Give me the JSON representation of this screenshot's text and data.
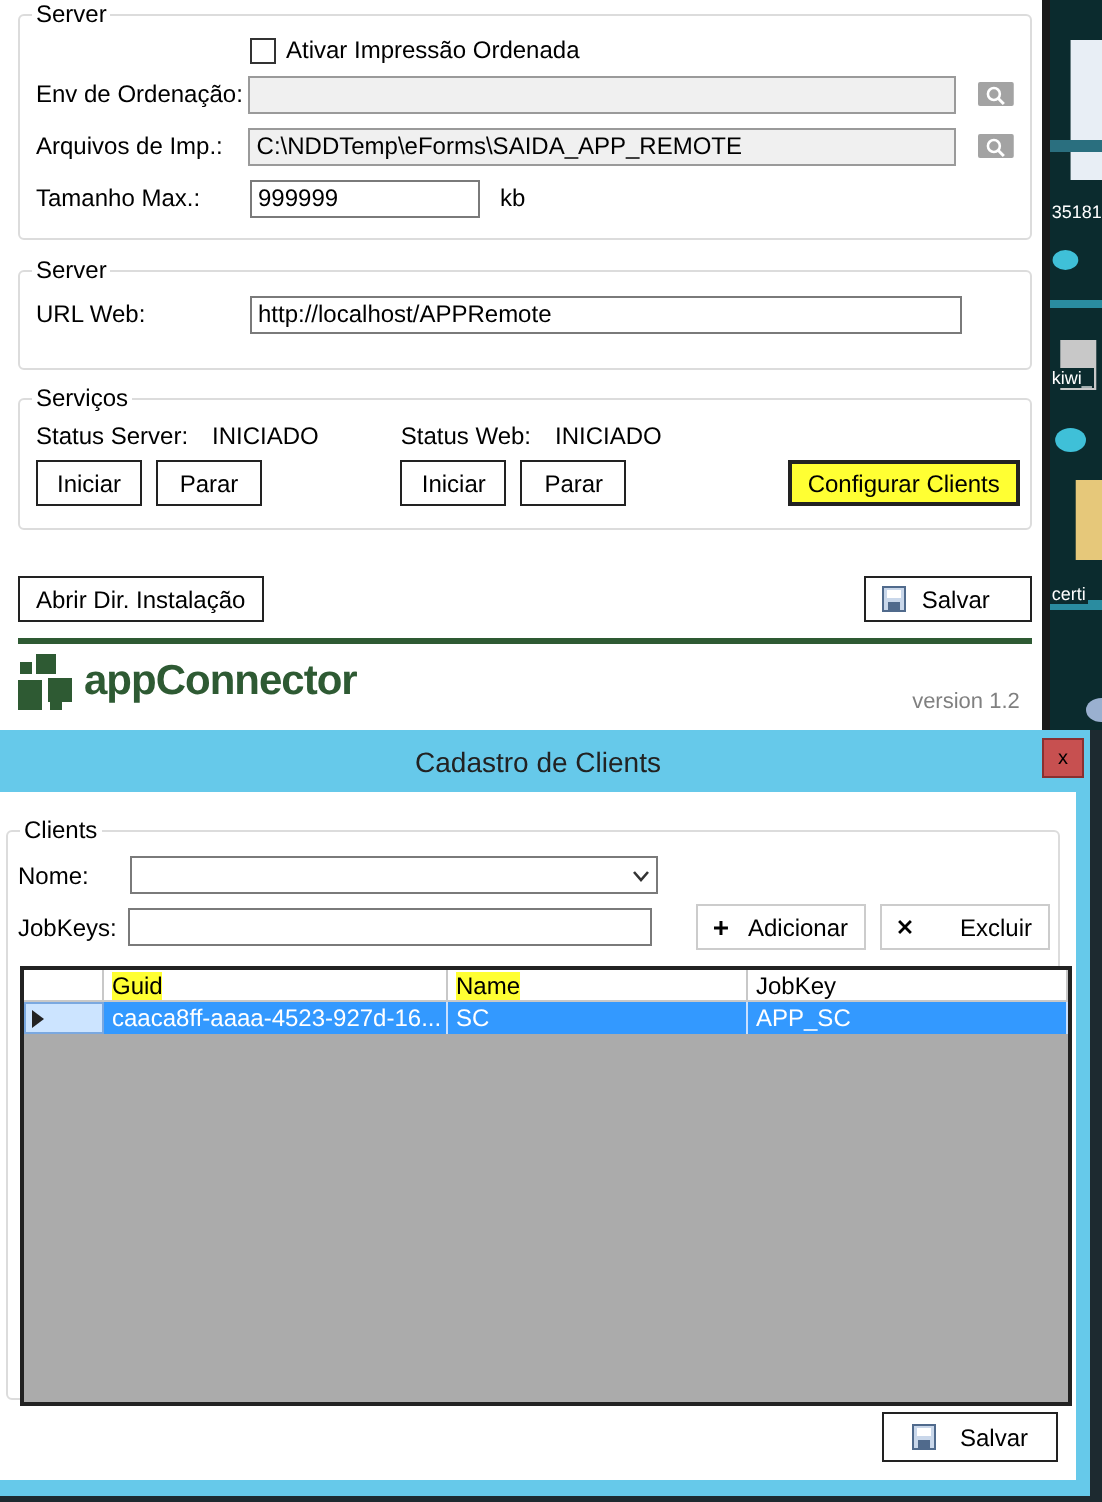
{
  "main_window": {
    "settings_group": {
      "legend": "Server",
      "checkbox": {
        "label": "Ativar Impressão Ordenada",
        "checked": false
      },
      "fields": [
        {
          "label": "Env de Ordenação:",
          "disabled": true,
          "browse": true
        },
        {
          "label": "Arquivos de Imp.:",
          "value": "C:\\NDDTemp\\eForms\\SAIDA_APP_REMOTE",
          "disabled": true,
          "browse": true
        },
        {
          "label": "Tamanho Max.:",
          "value": "999999",
          "unit": "kb",
          "disabled": false,
          "browse": false
        }
      ]
    },
    "web_group": {
      "legend": "Server",
      "fields": [
        {
          "label": "URL Web:",
          "value": "http://localhost/APPRemote",
          "disabled": false,
          "browse": false
        }
      ]
    },
    "services_group": {
      "legend": "Serviços",
      "statuses": [
        {
          "label": "Status Server:",
          "value": "INICIADO",
          "buttons": [
            "Iniciar",
            "Parar"
          ]
        },
        {
          "label": "Status Web:",
          "value": "INICIADO",
          "buttons": [
            "Iniciar",
            "Parar"
          ]
        }
      ],
      "configure_button": {
        "label": "Configurar Clients",
        "highlighted": true
      }
    },
    "open_dir_button": "Abrir Dir. Instalação",
    "save_button": "Salvar",
    "logo": "appConnector",
    "version": "version 1.2"
  },
  "desktop": {
    "icon_labels": [
      "35181",
      "kiwi_",
      "certi"
    ]
  },
  "dialog": {
    "title": "Cadastro de Clients",
    "close": "x",
    "group": "Clients",
    "name_label": "Nome:",
    "jobkeys_label": "JobKeys:",
    "add_button": "Adicionar",
    "delete_button": "Excluir",
    "table": {
      "columns": [
        {
          "label": "Guid",
          "highlighted": true
        },
        {
          "label": "Name",
          "highlighted": true
        },
        {
          "label": "JobKey",
          "highlighted": false
        }
      ],
      "rows": [
        {
          "cells": [
            "caaca8ff-aaaa-4523-927d-16...",
            "SC",
            "APP_SC"
          ],
          "selected": true
        }
      ]
    },
    "save_button": "Salvar"
  }
}
